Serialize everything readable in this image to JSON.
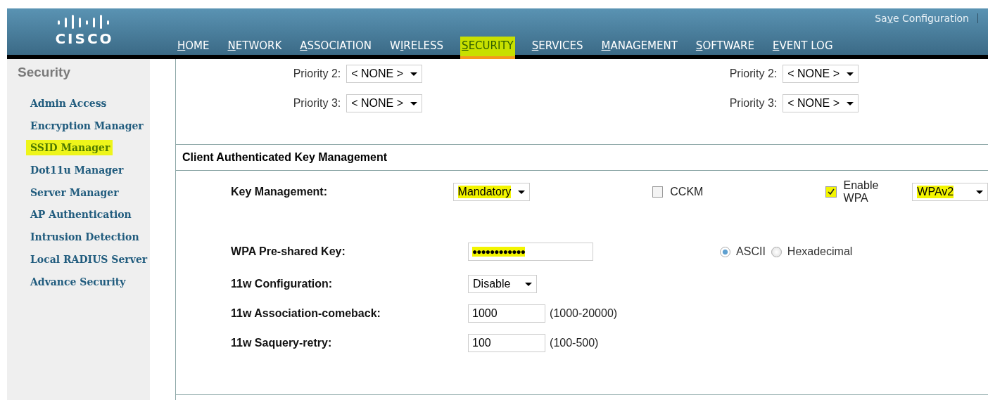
{
  "header": {
    "logo": "CISCO",
    "save_link": [
      "Sa",
      "v",
      "e Configuration"
    ],
    "nav": [
      {
        "parts": [
          "H",
          "OME"
        ],
        "selected": false,
        "highlighted": false
      },
      {
        "parts": [
          "N",
          "ETWORK"
        ],
        "selected": false,
        "highlighted": false
      },
      {
        "parts": [
          "A",
          "SSOCIATION"
        ],
        "selected": false,
        "highlighted": false
      },
      {
        "parts": [
          "W",
          "I",
          "RELESS"
        ],
        "selected": false,
        "highlighted": false
      },
      {
        "parts": [
          "S",
          "ECURITY"
        ],
        "selected": true,
        "highlighted": true
      },
      {
        "parts": [
          "S",
          "ERVICES"
        ],
        "selected": false,
        "highlighted": false
      },
      {
        "parts": [
          "M",
          "ANAGEMENT"
        ],
        "selected": false,
        "highlighted": false
      },
      {
        "parts": [
          "S",
          "OFTWARE"
        ],
        "selected": false,
        "highlighted": false
      },
      {
        "parts": [
          "E",
          "VENT LOG"
        ],
        "selected": false,
        "highlighted": false
      }
    ]
  },
  "sidebar": {
    "title": "Security",
    "items": [
      {
        "label": "Admin Access",
        "highlighted": false
      },
      {
        "label": "Encryption Manager",
        "highlighted": false
      },
      {
        "label": "SSID Manager",
        "highlighted": true
      },
      {
        "label": "Dot11u Manager",
        "highlighted": false
      },
      {
        "label": "Server Manager",
        "highlighted": false
      },
      {
        "label": "AP Authentication",
        "highlighted": false
      },
      {
        "label": "Intrusion Detection",
        "highlighted": false
      },
      {
        "label": "Local RADIUS Server",
        "highlighted": false
      },
      {
        "label": "Advance Security",
        "highlighted": false
      }
    ]
  },
  "priorities": [
    [
      {
        "label": "Priority 2:",
        "value": "< NONE >"
      },
      {
        "label": "Priority 2:",
        "value": "< NONE >"
      }
    ],
    [
      {
        "label": "Priority 3:",
        "value": "< NONE >"
      },
      {
        "label": "Priority 3:",
        "value": "< NONE >"
      }
    ]
  ],
  "section": {
    "title": "Client Authenticated Key Management",
    "key_management": {
      "label": "Key Management:",
      "value": "Mandatory",
      "highlighted": true
    },
    "cckm": {
      "label": "CCKM",
      "checked": false,
      "highlighted": false
    },
    "enable_wpa": {
      "label": "Enable WPA",
      "checked": true,
      "highlighted": true
    },
    "wpa_version": {
      "value": "WPAv2",
      "highlighted": true
    },
    "psk": {
      "label": "WPA Pre-shared Key:",
      "value": "●●●●●●●●●●●●",
      "highlighted": true
    },
    "key_format": [
      {
        "label": "ASCII",
        "selected": true
      },
      {
        "label": "Hexadecimal",
        "selected": false
      }
    ],
    "rows": [
      {
        "kind": "select",
        "label": "11w Configuration:",
        "value": "Disable"
      },
      {
        "kind": "input",
        "label": "11w Association-comeback:",
        "value": "1000",
        "hint": "(1000-20000)"
      },
      {
        "kind": "input",
        "label": "11w Saquery-retry:",
        "value": "100",
        "hint": "(100-500)"
      }
    ]
  }
}
